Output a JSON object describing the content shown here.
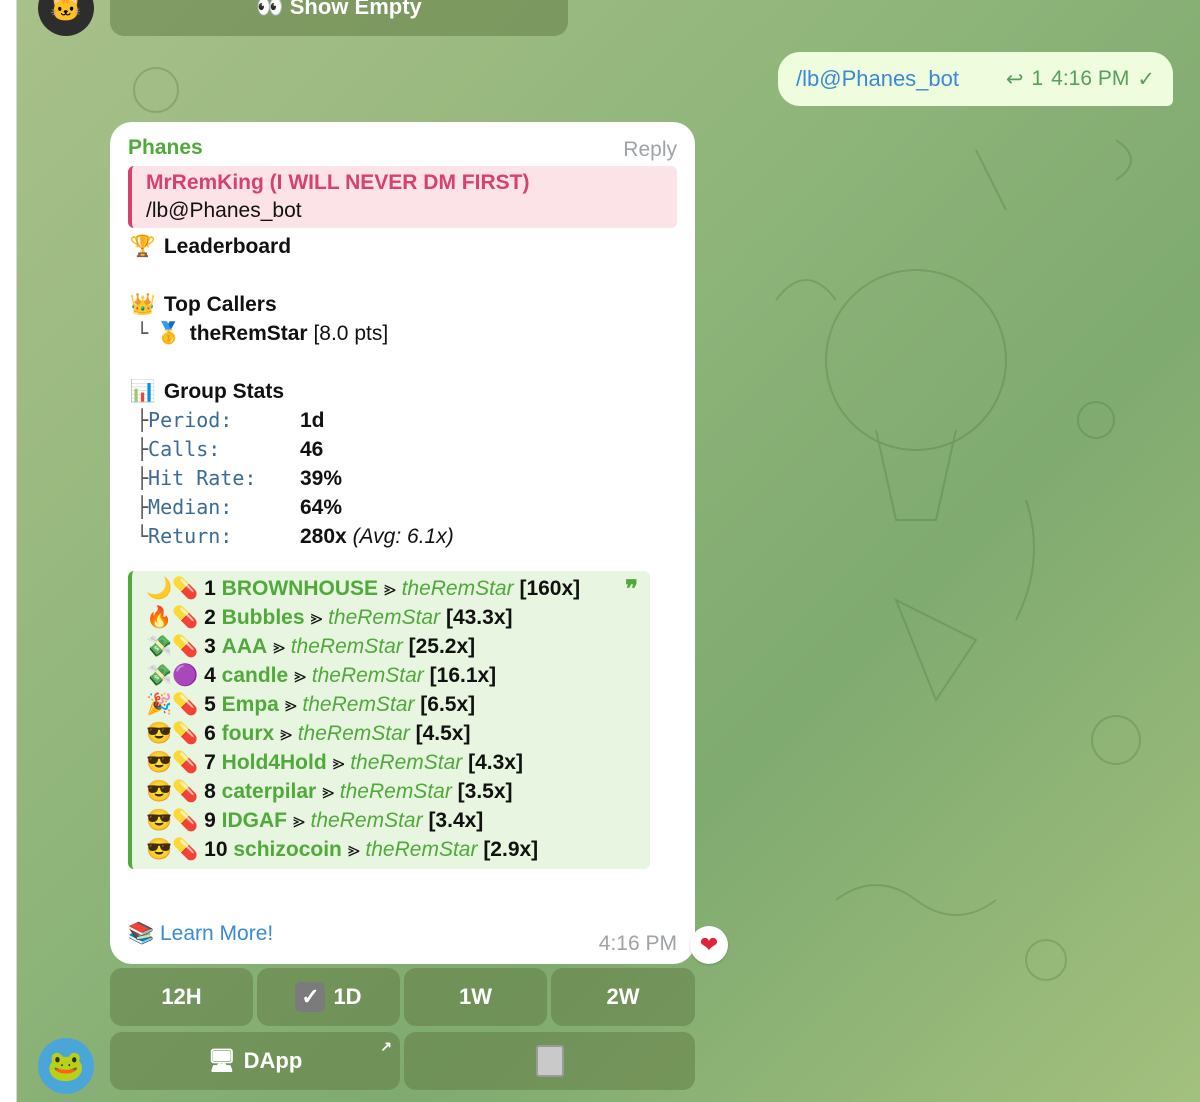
{
  "header_keyboard": {
    "show_empty": "👀 Show Empty"
  },
  "outgoing": {
    "text": "/lb@Phanes_bot",
    "reply_count": "1",
    "time": "4:16 PM",
    "check": "✓"
  },
  "message": {
    "sender": "Phanes",
    "reply_link": "Reply",
    "quote": {
      "name": "MrRemKing (I WILL NEVER DM FIRST)",
      "text": "/lb@Phanes_bot"
    },
    "leaderboard_title": "Leaderboard",
    "top_callers_title": "Top Callers",
    "top_caller": {
      "tree": "└",
      "name": "theRemStar",
      "pts": "[8.0 pts]"
    },
    "group_stats_title": "Group Stats",
    "stats": [
      {
        "tree": "├",
        "label": "Period:",
        "value": "1d"
      },
      {
        "tree": "├",
        "label": "Calls:",
        "value": "46"
      },
      {
        "tree": "├",
        "label": "Hit Rate:",
        "value": "39%"
      },
      {
        "tree": "├",
        "label": "Median:",
        "value": "64%"
      },
      {
        "tree": "└",
        "label": "Return:",
        "value": "280x",
        "extra": "(Avg: 6.1x)"
      }
    ],
    "leaders": [
      {
        "icons": "🌙💊",
        "rank": "1",
        "name": "BROWNHOUSE",
        "sep": "⪢",
        "user": "theRemStar",
        "mult": "[160x]"
      },
      {
        "icons": "🔥💊",
        "rank": "2",
        "name": "Bubbles",
        "sep": "⪢",
        "user": "theRemStar",
        "mult": "[43.3x]"
      },
      {
        "icons": "💸💊",
        "rank": "3",
        "name": "AAA",
        "sep": "⪢",
        "user": "theRemStar",
        "mult": "[25.2x]"
      },
      {
        "icons": "💸🟣",
        "rank": "4",
        "name": "candle",
        "sep": "⪢",
        "user": "theRemStar",
        "mult": "[16.1x]"
      },
      {
        "icons": "🎉💊",
        "rank": "5",
        "name": "Empa",
        "sep": "⪢",
        "user": "theRemStar",
        "mult": "[6.5x]"
      },
      {
        "icons": "😎💊",
        "rank": "6",
        "name": "fourx",
        "sep": "⪢",
        "user": "theRemStar",
        "mult": "[4.5x]"
      },
      {
        "icons": "😎💊",
        "rank": "7",
        "name": "Hold4Hold",
        "sep": "⪢",
        "user": "theRemStar",
        "mult": "[4.3x]"
      },
      {
        "icons": "😎💊",
        "rank": "8",
        "name": "caterpilar",
        "sep": "⪢",
        "user": "theRemStar",
        "mult": "[3.5x]"
      },
      {
        "icons": "😎💊",
        "rank": "9",
        "name": "IDGAF",
        "sep": "⪢",
        "user": "theRemStar",
        "mult": "[3.4x]"
      },
      {
        "icons": "😎💊",
        "rank": "10",
        "name": "schizocoin",
        "sep": "⪢",
        "user": "theRemStar",
        "mult": "[2.9x]"
      }
    ],
    "quote_mark": "❞",
    "learn_more": "Learn More!",
    "time": "4:16 PM",
    "reaction": "❤"
  },
  "keyboard": {
    "btn_12h": "12H",
    "btn_1d": "1D",
    "btn_1d_check": "✓",
    "btn_1w": "1W",
    "btn_2w": "2W",
    "btn_dapp": "DApp",
    "btn_dapp_arrow": "↗"
  },
  "icons": {
    "trophy": "🏆",
    "crown": "👑",
    "medal": "🥇",
    "chart": "📊",
    "books": "📚",
    "reply_arrow": "↩",
    "monitor": "🖥"
  }
}
